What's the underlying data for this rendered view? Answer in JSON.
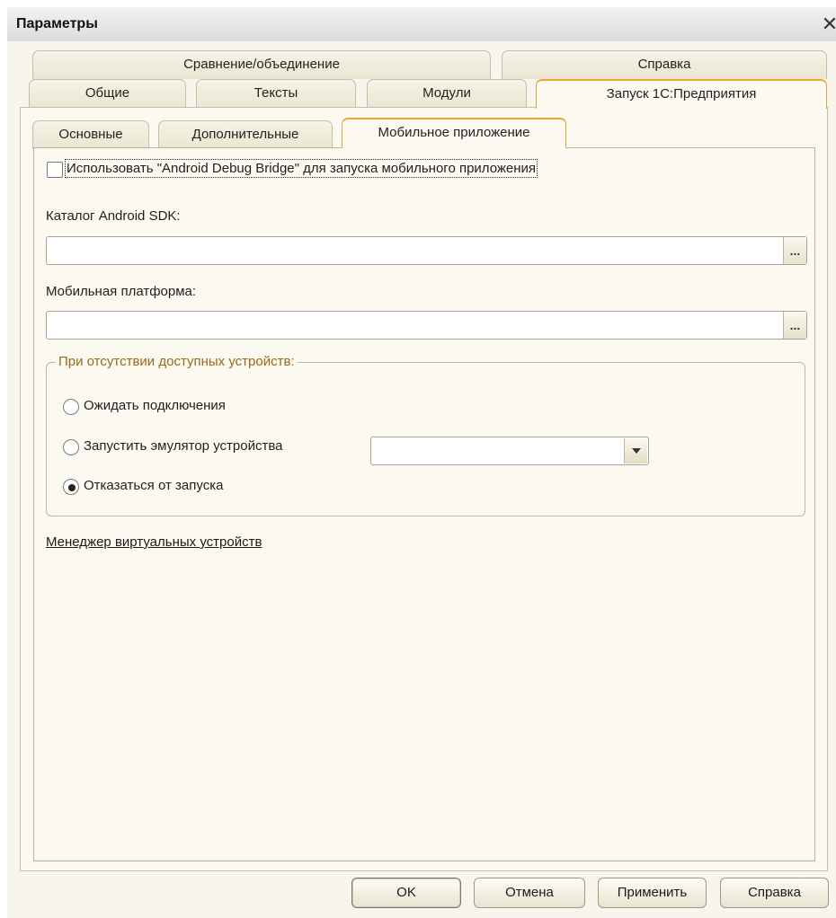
{
  "window": {
    "title": "Параметры",
    "close_glyph": "✕",
    "close_icon": "close-icon"
  },
  "tabs_top_row": [
    {
      "label": "Сравнение/объединение"
    },
    {
      "label": "Справка"
    }
  ],
  "tabs_second_row": [
    {
      "label": "Общие"
    },
    {
      "label": "Тексты"
    },
    {
      "label": "Модули"
    },
    {
      "label": "Запуск 1С:Предприятия",
      "active": true
    }
  ],
  "subtabs": [
    {
      "label": "Основные"
    },
    {
      "label": "Дополнительные"
    },
    {
      "label": "Мобильное приложение",
      "active": true
    }
  ],
  "adb_checkbox": {
    "label": "Использовать \"Android Debug Bridge\" для запуска мобильного приложения",
    "checked": false
  },
  "sdk": {
    "label": "Каталог Android SDK:",
    "value": "",
    "button": "..."
  },
  "platform": {
    "label": "Мобильная платформа:",
    "value": "",
    "button": "..."
  },
  "no_devices_group": {
    "title": "При отсутствии доступных устройств:",
    "options": [
      {
        "label": "Ожидать подключения",
        "selected": false
      },
      {
        "label": "Запустить эмулятор устройства",
        "selected": false
      },
      {
        "label": "Отказаться от запуска",
        "selected": true
      }
    ],
    "emulator_value": ""
  },
  "virtual_devices_link": "Менеджер виртуальных устройств",
  "buttons": {
    "ok": "OK",
    "cancel": "Отмена",
    "apply": "Применить",
    "help": "Справка"
  },
  "colors": {
    "dialog_bg": "#f7f5ec",
    "active_tab_accent": "#e8a838",
    "group_title": "#9a6a1c"
  }
}
